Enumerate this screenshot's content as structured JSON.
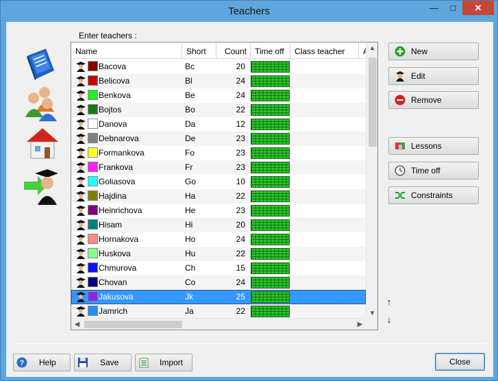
{
  "window": {
    "title": "Teachers",
    "min": "—",
    "max": "□",
    "close": "✕"
  },
  "caption": "Enter teachers :",
  "columns": {
    "name": "Name",
    "short": "Short",
    "count": "Count",
    "timeoff": "Time off",
    "classteacher": "Class teacher",
    "more": "A"
  },
  "rows": [
    {
      "name": "Bacova",
      "short": "Bc",
      "count": "20",
      "color": "#8b0000"
    },
    {
      "name": "Belicova",
      "short": "Bl",
      "count": "24",
      "color": "#cc0000"
    },
    {
      "name": "Benkova",
      "short": "Be",
      "count": "24",
      "color": "#22ee22"
    },
    {
      "name": "Bojtos",
      "short": "Bo",
      "count": "22",
      "color": "#1a7a1a"
    },
    {
      "name": "Danova",
      "short": "Da",
      "count": "12",
      "color": "#ffffff"
    },
    {
      "name": "Debnarova",
      "short": "De",
      "count": "23",
      "color": "#808080"
    },
    {
      "name": "Formankova",
      "short": "Fo",
      "count": "23",
      "color": "#ffff22"
    },
    {
      "name": "Frankova",
      "short": "Fr",
      "count": "23",
      "color": "#ff22ff"
    },
    {
      "name": "Goliasova",
      "short": "Go",
      "count": "10",
      "color": "#22ffff"
    },
    {
      "name": "Hajdina",
      "short": "Ha",
      "count": "22",
      "color": "#808000"
    },
    {
      "name": "Heinrichova",
      "short": "He",
      "count": "23",
      "color": "#800080"
    },
    {
      "name": "Hisam",
      "short": "Hi",
      "count": "20",
      "color": "#008080"
    },
    {
      "name": "Hornakova",
      "short": "Ho",
      "count": "24",
      "color": "#ff8888"
    },
    {
      "name": "Huskova",
      "short": "Hu",
      "count": "22",
      "color": "#88ff88"
    },
    {
      "name": "Chmurova",
      "short": "Ch",
      "count": "15",
      "color": "#1010ff"
    },
    {
      "name": "Chovan",
      "short": "Co",
      "count": "24",
      "color": "#000080"
    },
    {
      "name": "Jakusova",
      "short": "Jk",
      "count": "25",
      "color": "#8a2be2",
      "selected": true
    },
    {
      "name": "Jamrich",
      "short": "Ja",
      "count": "22",
      "color": "#1e90ff"
    }
  ],
  "right_buttons": {
    "new": "New",
    "edit": "Edit",
    "remove": "Remove",
    "lessons": "Lessons",
    "timeoff": "Time off",
    "constraints": "Constraints"
  },
  "bottom_buttons": {
    "help": "Help",
    "save": "Save",
    "import": "Import",
    "close": "Close"
  },
  "move_up": "↑",
  "move_down": "↓",
  "colors": {
    "titlebar": "#5fa6dc",
    "selection": "#3399ff",
    "timeoff_green": "#22cc22",
    "close_red": "#c7463a"
  }
}
